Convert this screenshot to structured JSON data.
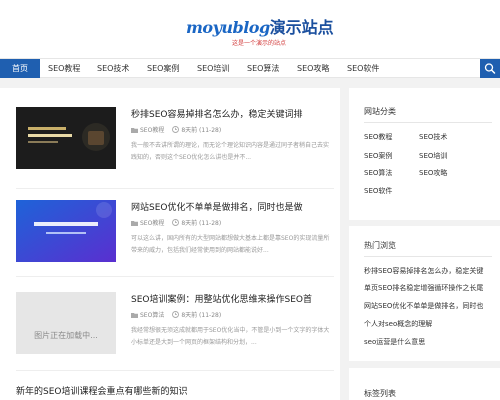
{
  "site": {
    "logo_latin": "moyublog",
    "logo_cjk": "演示站点",
    "tagline": "这是一个演示的站点"
  },
  "nav": {
    "items": [
      {
        "label": "首页"
      },
      {
        "label": "SEO教程"
      },
      {
        "label": "SEO技术"
      },
      {
        "label": "SEO案例"
      },
      {
        "label": "SEO培训"
      },
      {
        "label": "SEO算法"
      },
      {
        "label": "SEO攻略"
      },
      {
        "label": "SEO软件"
      }
    ],
    "active_index": 0
  },
  "articles": [
    {
      "title": "秒排SEO容易掉排名怎么办，稳定关键词排",
      "category": "SEO教程",
      "date": "8天前 (11-28)",
      "excerpt": "我一般不去讲所谓的理论，而无论个理论知识内容是通过同子者稍自己去实践知的，否则这个SEO优化怎么讲也是并不...",
      "thumb_text": "秒排SEO容易掉排名怎么办稳定关键词排名"
    },
    {
      "title": "网站SEO优化不单单是做排名，同时也是做",
      "category": "SEO教程",
      "date": "8天前 (11-28)",
      "excerpt": "可以这么讲，国内所有的大型网站都想做大基本上都是靠SEO的实现流量所带来的威力，包括我们经常使用到的网站都能说好...",
      "thumb_text": "某某网站优化精修SEO服务"
    },
    {
      "title": "SEO培训案例：用整站优化思维来操作SEO首",
      "category": "SEO算法",
      "date": "8天前 (11-28)",
      "excerpt": "我经常想很无须这成就都用于SEO优化当中，不管是小到一个文字的字体大小标单还是大到一个网页的框架结构和分划，...",
      "thumb_text": "图片正在加载中..."
    },
    {
      "title": "新年的SEO培训课程会重点有哪些新的知识"
    }
  ],
  "sidebar": {
    "categories_title": "网站分类",
    "categories": [
      "SEO教程",
      "SEO技术",
      "SEO案例",
      "SEO培训",
      "SEO算法",
      "SEO攻略",
      "SEO软件"
    ],
    "hot_title": "热门浏览",
    "hot_items": [
      "秒排SEO容易掉排名怎么办，稳定关键",
      "单页SEO排名稳定增强循环操作之长尾",
      "网站SEO优化不单单是做排名，同时也",
      "个人对seo概念的理解",
      "seo运营是什么意思"
    ],
    "tags_title": "标签列表"
  },
  "colors": {
    "brand_blue": "#1f5fb0",
    "page_bg": "#f2f2f2"
  },
  "icons": {
    "search": "search-icon",
    "category": "folder-icon",
    "time": "clock-icon"
  }
}
